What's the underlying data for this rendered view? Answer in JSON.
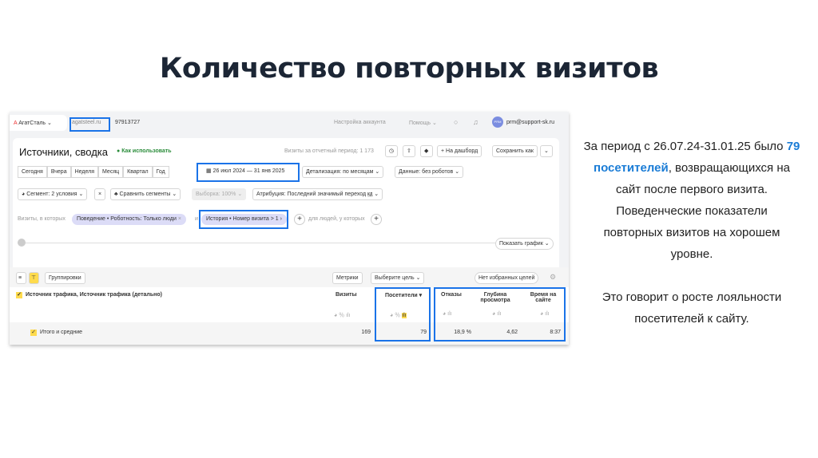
{
  "title": "Количество повторных визитов",
  "screenshot": {
    "topbar": {
      "org": "АгатСталь",
      "site": "agatsteel.ru",
      "counter": "97913727",
      "account_settings": "Настройка аккаунта",
      "help": "Помощь",
      "user": "prm@support-sk.ru",
      "avatar": "PRM"
    },
    "report": {
      "title": "Источники, сводка",
      "how_to": "Как использовать",
      "visits_info": "Визиты за отчетный период: 1 173",
      "to_dashboard": "+ На дашборд",
      "save_as": "Сохранить как"
    },
    "periods": [
      "Сегодня",
      "Вчера",
      "Неделя",
      "Месяц",
      "Квартал",
      "Год"
    ],
    "date_range": "26 июл 2024 — 31 янв 2025",
    "detail": "Детализация: по месяцам",
    "data_filter": "Данные: без роботов",
    "segment": "Сегмент: 2 условия",
    "compare": "Сравнить сегменты",
    "sample": "Выборка: 100%",
    "attribution": "Атрибуция: Последний значимый переход",
    "attribution_badge": "КД",
    "visits_where": "Визиты, в которых",
    "cond1": "Поведение • Роботность: Только люди",
    "and": "и",
    "cond2": "История • Номер визита > 1",
    "people_where": "для людей, у которых",
    "show_chart": "Показать график",
    "groupings": "Группировки",
    "metrics": "Метрики",
    "goal": "Выберите цель",
    "no_goals": "Нет избранных целей",
    "dimension": "Источник трафика, Источник трафика (детально)",
    "columns": [
      "Визиты",
      "Посетители",
      "Отказы",
      "Глубина просмотра",
      "Время на сайте"
    ],
    "totals_label": "Итого и средние",
    "totals": [
      "169",
      "79",
      "18,9 %",
      "4,62",
      "8:37"
    ]
  },
  "text": {
    "l1a": "За период с 26.07.24-31.01.25 было ",
    "l1b": "79",
    "l2a": "посетителей",
    "l2b": ", возвращающихся на",
    "l3": "сайт после первого визита.",
    "l4": "Поведенческие показатели",
    "l5": "повторных визитов на хорошем",
    "l6": "уровне.",
    "l7": "Это говорит о росте лояльности",
    "l8": "посетителей к сайту."
  }
}
